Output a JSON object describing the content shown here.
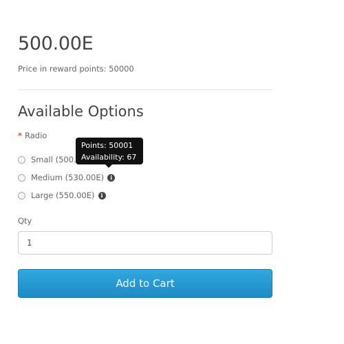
{
  "product": {
    "price": "500.00E",
    "reward_points": "Price in reward points: 50000"
  },
  "options": {
    "title": "Available Options",
    "required_marker": "*",
    "radio_label": "Radio",
    "items": [
      {
        "label": "Small (500.",
        "info_icon": "info-icon"
      },
      {
        "label": "Medium (530.00E)",
        "info_icon": "info-icon"
      },
      {
        "label": "Large (550.00E)",
        "info_icon": "info-icon"
      }
    ]
  },
  "tooltip": {
    "line1": "Points: 50001",
    "line2": "Availability: 67"
  },
  "quantity": {
    "label": "Qty",
    "value": "1"
  },
  "cart": {
    "button_label": "Add to Cart",
    "color": "#2a9fd6"
  }
}
